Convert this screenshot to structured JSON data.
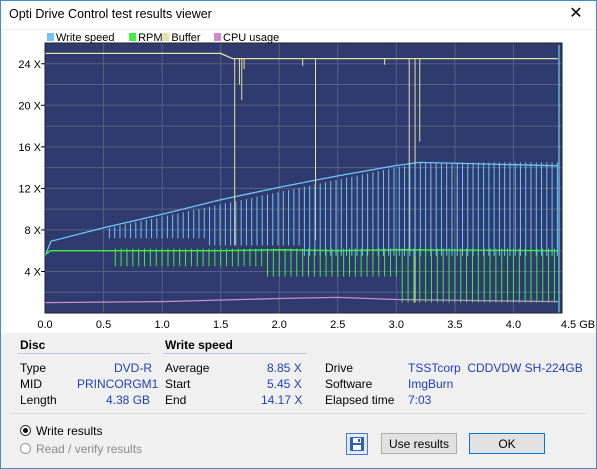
{
  "window": {
    "title": "Opti Drive Control test results viewer",
    "close_glyph": "✕"
  },
  "chart": {
    "legend": [
      {
        "label": "Write speed",
        "color": "#6fc6f6"
      },
      {
        "label": "RPM",
        "color": "#40ee40"
      },
      {
        "label": "Buffer",
        "color": "#e4e2a8"
      },
      {
        "label": "CPU usage",
        "color": "#d08bd0"
      }
    ],
    "y_ticks": [
      "4 X",
      "8 X",
      "12 X",
      "16 X",
      "20 X",
      "24 X"
    ],
    "x_ticks": [
      "0.0",
      "0.5",
      "1.0",
      "1.5",
      "2.0",
      "2.5",
      "3.0",
      "3.5",
      "4.0",
      "4.5 GB"
    ]
  },
  "chart_data": {
    "type": "line",
    "xlim": [
      0,
      4.5
    ],
    "ylim": [
      0,
      26
    ],
    "xunit": "GB",
    "yunit": "X",
    "grid": true,
    "legend_position": "top-left",
    "series": [
      {
        "name": "Write speed",
        "color": "#6fc6f6",
        "x": [
          0.0,
          0.05,
          0.5,
          1.0,
          1.5,
          2.0,
          2.5,
          3.0,
          3.2,
          4.38
        ],
        "y": [
          5.45,
          6.9,
          8.2,
          9.5,
          10.9,
          12.1,
          13.2,
          14.2,
          14.5,
          14.17
        ]
      },
      {
        "name": "RPM",
        "color": "#40ee40",
        "x": [
          0.0,
          0.05,
          0.5,
          1.0,
          1.5,
          2.0,
          2.5,
          3.0,
          4.38
        ],
        "y": [
          5.6,
          6.0,
          6.0,
          6.0,
          6.0,
          6.1,
          6.0,
          6.1,
          6.0
        ]
      },
      {
        "name": "Buffer",
        "color": "#e4e2a8",
        "x": [
          0.0,
          1.5,
          1.6,
          2.3,
          3.1,
          4.38
        ],
        "y": [
          25.0,
          25.0,
          24.5,
          24.5,
          24.5,
          24.5
        ]
      },
      {
        "name": "CPU usage",
        "color": "#d08bd0",
        "x": [
          0.0,
          1.0,
          2.0,
          2.5,
          3.0,
          4.38
        ],
        "y": [
          1.0,
          1.1,
          1.4,
          1.5,
          1.3,
          1.1
        ]
      }
    ]
  },
  "disc": {
    "header": "Disc",
    "type_label": "Type",
    "type_value": "DVD-R",
    "mid_label": "MID",
    "mid_value": "PRINCORGM1",
    "length_label": "Length",
    "length_value": "4.38 GB"
  },
  "write_speed": {
    "header": "Write speed",
    "avg_label": "Average",
    "avg_value": "8.85 X",
    "start_label": "Start",
    "start_value": "5.45 X",
    "end_label": "End",
    "end_value": "14.17 X"
  },
  "drive_info": {
    "drive_label": "Drive",
    "drive_value": "TSSTcorp  CDDVDW SH-224GB",
    "software_label": "Software",
    "software_value": "ImgBurn",
    "elapsed_label": "Elapsed time",
    "elapsed_value": "7:03"
  },
  "options": {
    "write_results": "Write results",
    "read_verify": "Read / verify results"
  },
  "buttons": {
    "use_results": "Use results",
    "ok": "OK"
  }
}
